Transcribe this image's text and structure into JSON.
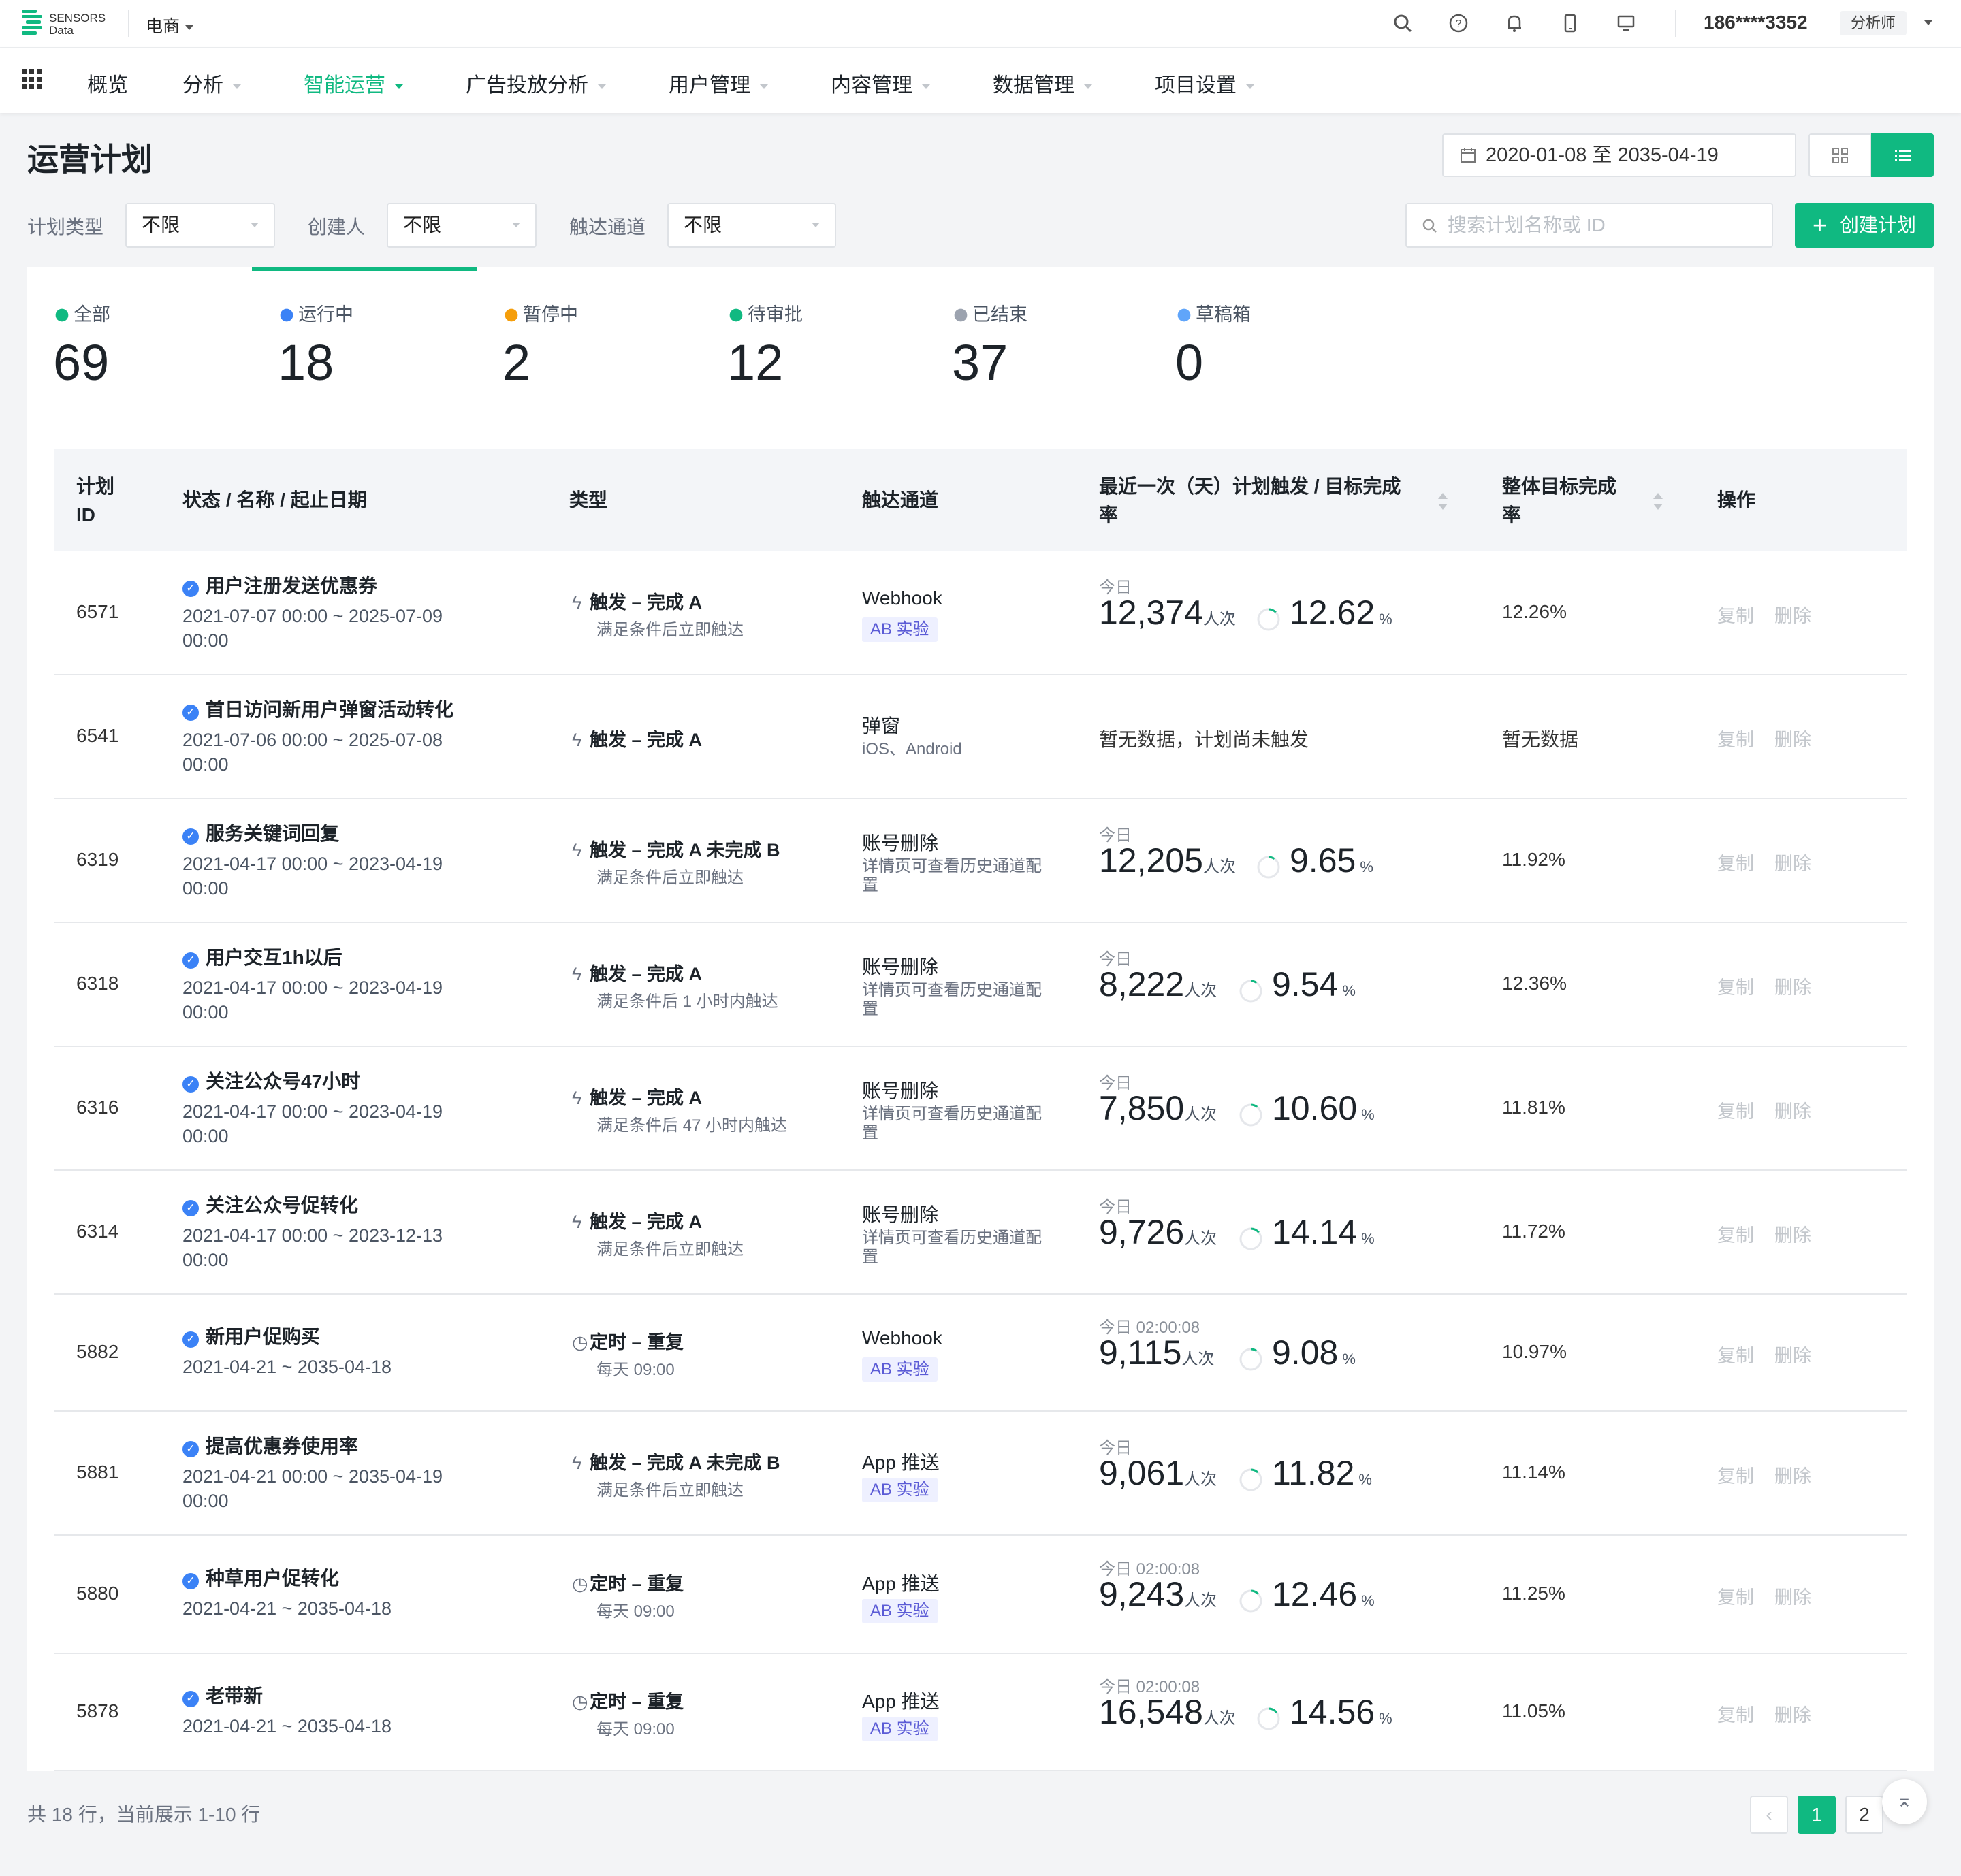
{
  "header": {
    "logo_text_line1": "SENSORS",
    "logo_text_line2": "Data",
    "project": "电商",
    "user": "186****3352",
    "role": "分析师",
    "icons": [
      "search-icon",
      "help-icon",
      "bell-icon",
      "mobile-icon",
      "monitor-icon"
    ]
  },
  "menu": [
    {
      "label": "概览",
      "dropdown": false,
      "active": false
    },
    {
      "label": "分析",
      "dropdown": true,
      "active": false
    },
    {
      "label": "智能运营",
      "dropdown": true,
      "active": true
    },
    {
      "label": "广告投放分析",
      "dropdown": true,
      "active": false
    },
    {
      "label": "用户管理",
      "dropdown": true,
      "active": false
    },
    {
      "label": "内容管理",
      "dropdown": true,
      "active": false
    },
    {
      "label": "数据管理",
      "dropdown": true,
      "active": false
    },
    {
      "label": "项目设置",
      "dropdown": true,
      "active": false
    }
  ],
  "page": {
    "title": "运营计划",
    "date_range": "2020-01-08 至 2035-04-19",
    "filters": [
      {
        "label": "计划类型",
        "value": "不限"
      },
      {
        "label": "创建人",
        "value": "不限"
      },
      {
        "label": "触达通道",
        "value": "不限"
      }
    ],
    "search_placeholder": "搜索计划名称或 ID",
    "create_label": "创建计划"
  },
  "tabs": [
    {
      "label": "全部",
      "count": "69",
      "icon": "clipboard-icon",
      "color": "#10b981"
    },
    {
      "label": "运行中",
      "count": "18",
      "icon": "check-circle-icon",
      "color": "#3b82f6"
    },
    {
      "label": "暂停中",
      "count": "2",
      "icon": "pause-circle-icon",
      "color": "#f59e0b"
    },
    {
      "label": "待审批",
      "count": "12",
      "icon": "approval-icon",
      "color": "#10b981"
    },
    {
      "label": "已结束",
      "count": "37",
      "icon": "minus-circle-icon",
      "color": "#9ca3af"
    },
    {
      "label": "草稿箱",
      "count": "0",
      "icon": "draft-icon",
      "color": "#60a5fa"
    }
  ],
  "table": {
    "headers": {
      "id": "计划\nID",
      "name": "状态 / 名称 / 起止日期",
      "type": "类型",
      "channel": "触达通道",
      "recent": "最近一次（天）计划触发 / 目标完成\n率",
      "overall": "整体目标完成\n率",
      "ops": "操作"
    },
    "rows": [
      {
        "id": "6571",
        "name": "用户注册发送优惠券",
        "date1": "2021-07-07 00:00 ~ 2025-07-09",
        "date2": "00:00",
        "type_icon": "bolt-icon",
        "type": "触发 – 完成 A",
        "type_sub": "满足条件后立即触达",
        "channel": "Webhook",
        "ab": "AB 实验",
        "ch_sub1": "",
        "ch_sub2": "",
        "today": "今日",
        "num": "12,374",
        "unit": "人次",
        "pct": "12.62",
        "pct_unit": "%",
        "progress": 0.1262,
        "nodata": "",
        "overall": "12.26%",
        "copy": "复制",
        "del": "删除"
      },
      {
        "id": "6541",
        "name": "首日访问新用户弹窗活动转化",
        "date1": "2021-07-06 00:00 ~ 2025-07-08",
        "date2": "00:00",
        "type_icon": "bolt-icon",
        "type": "触发 – 完成 A",
        "type_sub": "",
        "channel": "弹窗",
        "ab": "",
        "ch_sub1": "iOS、Android",
        "ch_sub2": "",
        "today": "",
        "num": "",
        "unit": "",
        "pct": "",
        "pct_unit": "",
        "progress": 0,
        "nodata": "暂无数据，计划尚未触发",
        "overall": "暂无数据",
        "copy": "复制",
        "del": "删除"
      },
      {
        "id": "6319",
        "name": "服务关键词回复",
        "date1": "2021-04-17 00:00 ~ 2023-04-19",
        "date2": "00:00",
        "type_icon": "bolt-icon",
        "type": "触发 – 完成 A 未完成 B",
        "type_sub": "满足条件后立即触达",
        "channel": "账号删除",
        "ab": "",
        "ch_sub1": "详情页可查看历史通道配",
        "ch_sub2": "置",
        "today": "今日",
        "num": "12,205",
        "unit": "人次",
        "pct": "9.65",
        "pct_unit": "%",
        "progress": 0.0965,
        "nodata": "",
        "overall": "11.92%",
        "copy": "复制",
        "del": "删除"
      },
      {
        "id": "6318",
        "name": "用户交互1h以后",
        "date1": "2021-04-17 00:00 ~ 2023-04-19",
        "date2": "00:00",
        "type_icon": "bolt-icon",
        "type": "触发 – 完成 A",
        "type_sub": "满足条件后 1 小时内触达",
        "channel": "账号删除",
        "ab": "",
        "ch_sub1": "详情页可查看历史通道配",
        "ch_sub2": "置",
        "today": "今日",
        "num": "8,222",
        "unit": "人次",
        "pct": "9.54",
        "pct_unit": "%",
        "progress": 0.0954,
        "nodata": "",
        "overall": "12.36%",
        "copy": "复制",
        "del": "删除"
      },
      {
        "id": "6316",
        "name": "关注公众号47小时",
        "date1": "2021-04-17 00:00 ~ 2023-04-19",
        "date2": "00:00",
        "type_icon": "bolt-icon",
        "type": "触发 – 完成 A",
        "type_sub": "满足条件后 47 小时内触达",
        "channel": "账号删除",
        "ab": "",
        "ch_sub1": "详情页可查看历史通道配",
        "ch_sub2": "置",
        "today": "今日",
        "num": "7,850",
        "unit": "人次",
        "pct": "10.60",
        "pct_unit": "%",
        "progress": 0.106,
        "nodata": "",
        "overall": "11.81%",
        "copy": "复制",
        "del": "删除"
      },
      {
        "id": "6314",
        "name": "关注公众号促转化",
        "date1": "2021-04-17 00:00 ~ 2023-12-13",
        "date2": "00:00",
        "type_icon": "bolt-icon",
        "type": "触发 – 完成 A",
        "type_sub": "满足条件后立即触达",
        "channel": "账号删除",
        "ab": "",
        "ch_sub1": "详情页可查看历史通道配",
        "ch_sub2": "置",
        "today": "今日",
        "num": "9,726",
        "unit": "人次",
        "pct": "14.14",
        "pct_unit": "%",
        "progress": 0.1414,
        "nodata": "",
        "overall": "11.72%",
        "copy": "复制",
        "del": "删除"
      },
      {
        "id": "5882",
        "name": "新用户促购买",
        "date1": "2021-04-21 ~ 2035-04-18",
        "date2": "",
        "type_icon": "clock-icon",
        "type": "定时 – 重复",
        "type_sub": "每天 09:00",
        "channel": "Webhook",
        "ab": "AB 实验",
        "ch_sub1": "",
        "ch_sub2": "",
        "today": "今日 02:00:08",
        "num": "9,115",
        "unit": "人次",
        "pct": "9.08",
        "pct_unit": "%",
        "progress": 0.0908,
        "nodata": "",
        "overall": "10.97%",
        "copy": "复制",
        "del": "删除"
      },
      {
        "id": "5881",
        "name": "提高优惠券使用率",
        "date1": "2021-04-21 00:00 ~ 2035-04-19",
        "date2": "00:00",
        "type_icon": "bolt-icon",
        "type": "触发 – 完成 A 未完成 B",
        "type_sub": "满足条件后立即触达",
        "channel": "App 推送",
        "ab": "AB 实验",
        "ch_sub1": "",
        "ch_sub2": "",
        "today": "今日",
        "num": "9,061",
        "unit": "人次",
        "pct": "11.82",
        "pct_unit": "%",
        "progress": 0.1182,
        "nodata": "",
        "overall": "11.14%",
        "copy": "复制",
        "del": "删除"
      },
      {
        "id": "5880",
        "name": "种草用户促转化",
        "date1": "2021-04-21 ~ 2035-04-18",
        "date2": "",
        "type_icon": "clock-icon",
        "type": "定时 – 重复",
        "type_sub": "每天 09:00",
        "channel": "App 推送",
        "ab": "AB 实验",
        "ch_sub1": "",
        "ch_sub2": "",
        "today": "今日 02:00:08",
        "num": "9,243",
        "unit": "人次",
        "pct": "12.46",
        "pct_unit": "%",
        "progress": 0.1246,
        "nodata": "",
        "overall": "11.25%",
        "copy": "复制",
        "del": "删除"
      },
      {
        "id": "5878",
        "name": "老带新",
        "date1": "2021-04-21 ~ 2035-04-18",
        "date2": "",
        "type_icon": "clock-icon",
        "type": "定时 – 重复",
        "type_sub": "每天 09:00",
        "channel": "App 推送",
        "ab": "AB 实验",
        "ch_sub1": "",
        "ch_sub2": "",
        "today": "今日 02:00:08",
        "num": "16,548",
        "unit": "人次",
        "pct": "14.56",
        "pct_unit": "%",
        "progress": 0.1456,
        "nodata": "",
        "overall": "11.05%",
        "copy": "复制",
        "del": "删除"
      }
    ]
  },
  "footer": {
    "summary": "共 18 行，当前展示 1-10 行",
    "pages": [
      "1",
      "2"
    ],
    "current_page": "1"
  },
  "colors": {
    "accent": "#10b981",
    "check": "#3b82f6"
  }
}
